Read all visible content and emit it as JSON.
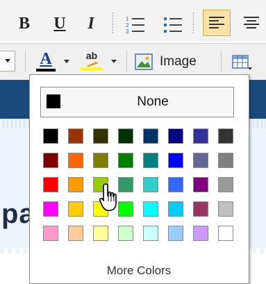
{
  "toolbar": {
    "bold_label": "B",
    "underline_label": "U",
    "italic_label": "I",
    "numbered_list_icon": "numbered-list-icon",
    "bullet_list_icon": "bullet-list-icon",
    "align_left_icon": "align-left-icon",
    "align_center_icon": "align-center-icon",
    "font_color_label": "A",
    "highlight_label": "ab",
    "image_label": "Image",
    "table_icon": "table-icon"
  },
  "color_picker": {
    "none_label": "None",
    "more_colors_label": "More Colors",
    "selected_color": "#88b400",
    "rows": [
      [
        "#000000",
        "#993300",
        "#333300",
        "#003300",
        "#003366",
        "#000080",
        "#333399",
        "#333333"
      ],
      [
        "#800000",
        "#ff6600",
        "#808000",
        "#008000",
        "#008080",
        "#0000ff",
        "#666699",
        "#808080"
      ],
      [
        "#ff0000",
        "#ff9900",
        "#99cc00",
        "#339966",
        "#33cccc",
        "#3366ff",
        "#800080",
        "#999999"
      ],
      [
        "#ff00ff",
        "#ffcc00",
        "#ffff00",
        "#00ff00",
        "#00ffff",
        "#00ccff",
        "#993366",
        "#c0c0c0"
      ],
      [
        "#ff99cc",
        "#ffcc99",
        "#ffff99",
        "#ccffcc",
        "#ccffff",
        "#99ccff",
        "#cc99ff",
        "#ffffff"
      ]
    ]
  },
  "colors": {
    "header_band": "#1b4b7c",
    "selected_border": "#8a6a00"
  }
}
